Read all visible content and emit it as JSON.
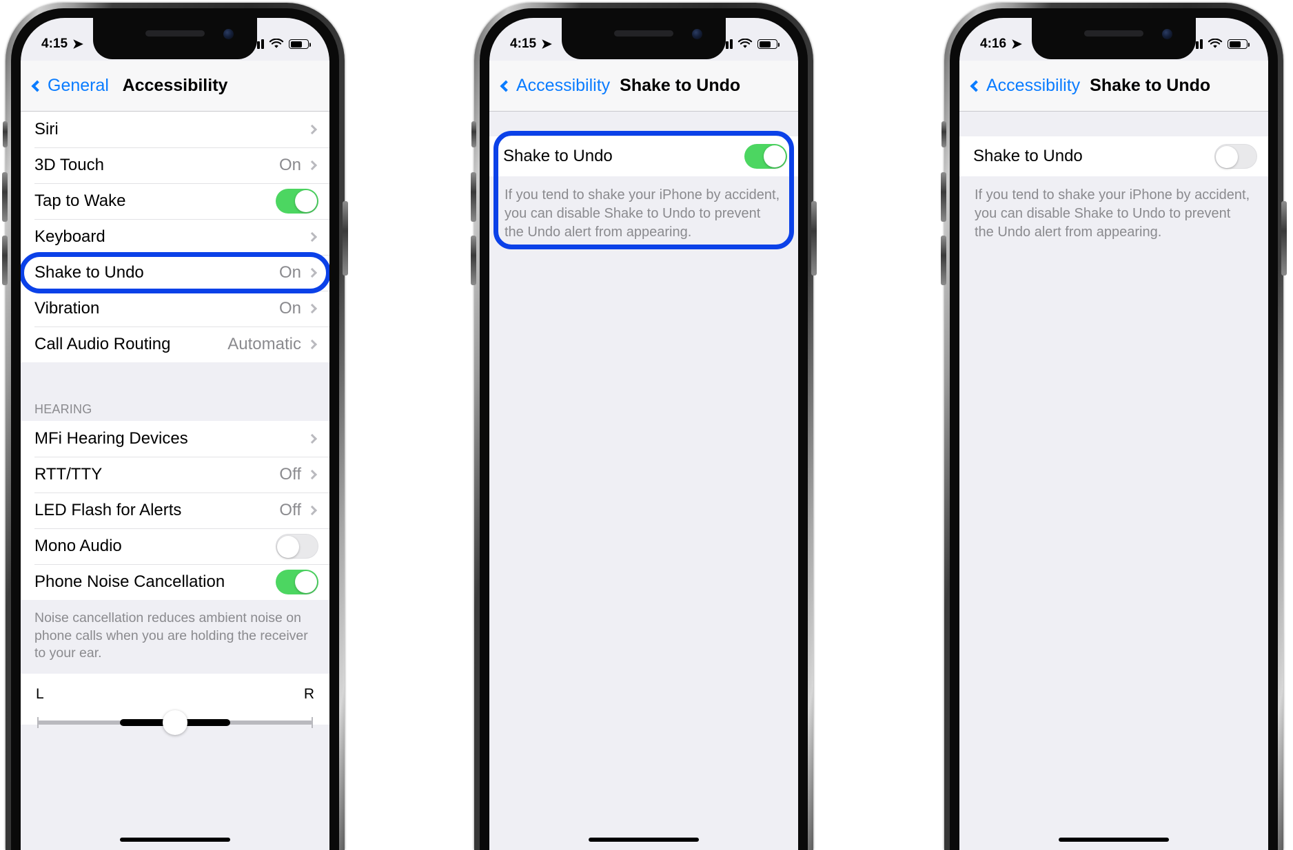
{
  "phones": [
    {
      "id": "phone-accessibility-list",
      "status": {
        "time": "4:15",
        "location_arrow": "➤",
        "battery_level": 70
      },
      "nav": {
        "back_label": "General",
        "title": "Accessibility",
        "title_centered": true
      },
      "sections": [
        {
          "rows": [
            {
              "label": "Siri",
              "value": "",
              "accessory": "chevron"
            },
            {
              "label": "3D Touch",
              "value": "On",
              "accessory": "chevron"
            },
            {
              "label": "Tap to Wake",
              "value": "",
              "accessory": "toggle-on"
            },
            {
              "label": "Keyboard",
              "value": "",
              "accessory": "chevron"
            },
            {
              "label": "Shake to Undo",
              "value": "On",
              "accessory": "chevron",
              "highlighted": true
            },
            {
              "label": "Vibration",
              "value": "On",
              "accessory": "chevron"
            },
            {
              "label": "Call Audio Routing",
              "value": "Automatic",
              "accessory": "chevron"
            }
          ]
        },
        {
          "header": "HEARING",
          "rows": [
            {
              "label": "MFi Hearing Devices",
              "value": "",
              "accessory": "chevron"
            },
            {
              "label": "RTT/TTY",
              "value": "Off",
              "accessory": "chevron"
            },
            {
              "label": "LED Flash for Alerts",
              "value": "Off",
              "accessory": "chevron"
            },
            {
              "label": "Mono Audio",
              "value": "",
              "accessory": "toggle-off"
            },
            {
              "label": "Phone Noise Cancellation",
              "value": "",
              "accessory": "toggle-on"
            }
          ],
          "footer": "Noise cancellation reduces ambient noise on phone calls when you are holding the receiver to your ear."
        }
      ],
      "balance": {
        "left_label": "L",
        "right_label": "R"
      }
    },
    {
      "id": "phone-shake-to-undo-on",
      "status": {
        "time": "4:15",
        "location_arrow": "➤",
        "battery_level": 70
      },
      "nav": {
        "back_label": "Accessibility",
        "title": "Shake to Undo",
        "title_centered": false
      },
      "setting": {
        "label": "Shake to Undo",
        "state": "on",
        "description": "If you tend to shake your iPhone by accident, you can disable Shake to Undo to prevent the Undo alert from appearing.",
        "highlighted": true
      }
    },
    {
      "id": "phone-shake-to-undo-off",
      "status": {
        "time": "4:16",
        "location_arrow": "➤",
        "battery_level": 70
      },
      "nav": {
        "back_label": "Accessibility",
        "title": "Shake to Undo",
        "title_centered": false
      },
      "setting": {
        "label": "Shake to Undo",
        "state": "off",
        "description": "If you tend to shake your iPhone by accident, you can disable Shake to Undo to prevent the Undo alert from appearing.",
        "highlighted": false
      }
    }
  ],
  "colors": {
    "accent_blue": "#0a7cff",
    "highlight_blue": "#0b41e8",
    "toggle_green": "#4cd661",
    "secondary_text": "#8a8a8e",
    "list_background": "#efeff4"
  }
}
